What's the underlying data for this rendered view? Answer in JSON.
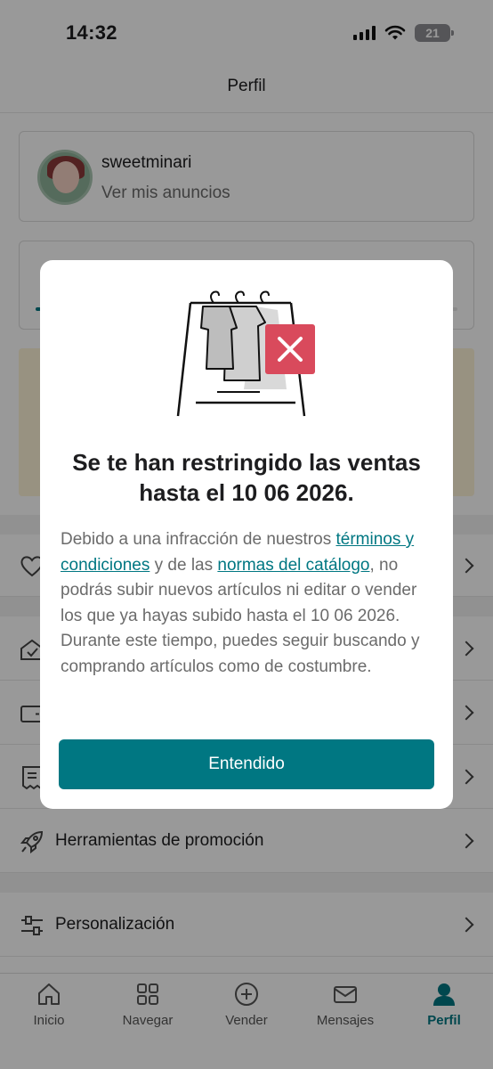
{
  "status_bar": {
    "time": "14:32",
    "battery": "21"
  },
  "header": {
    "title": "Perfil"
  },
  "profile": {
    "username": "sweetminari",
    "subtitle": "Ver mis anuncios"
  },
  "list_items": [
    {
      "label": "",
      "icon": "heart-icon"
    },
    {
      "label": "",
      "icon": "shield-icon"
    },
    {
      "label": "",
      "icon": "wallet-icon"
    },
    {
      "label": "",
      "icon": "receipt-icon"
    },
    {
      "label": "Herramientas de promoción",
      "icon": "rocket-icon"
    },
    {
      "label": "Personalización",
      "icon": "sliders-icon"
    }
  ],
  "tabs": [
    {
      "label": "Inicio",
      "icon": "home-icon"
    },
    {
      "label": "Navegar",
      "icon": "grid-icon"
    },
    {
      "label": "Vender",
      "icon": "plus-circle-icon"
    },
    {
      "label": "Mensajes",
      "icon": "mail-icon"
    },
    {
      "label": "Perfil",
      "icon": "person-icon",
      "active": true
    }
  ],
  "modal": {
    "title": "Se te han restringido las ventas hasta el 10 06 2026.",
    "body_part1": "Debido a una infracción de nuestros ",
    "link_terms": "términos y condiciones",
    "body_part2": " y de las ",
    "link_catalog": "normas del catálogo",
    "body_part3": ", no podrás subir nuevos artículos ni editar o vender los que ya hayas subido hasta el 10 06 2026. Durante este tiempo, puedes seguir buscando y comprando artículos como de costumbre.",
    "button_label": "Entendido",
    "illustration": "clothing-rack-blocked-illustration"
  },
  "colors": {
    "accent": "#007782",
    "alert_red": "#d94a5c",
    "overlay": "rgba(0,0,0,0.40)"
  }
}
